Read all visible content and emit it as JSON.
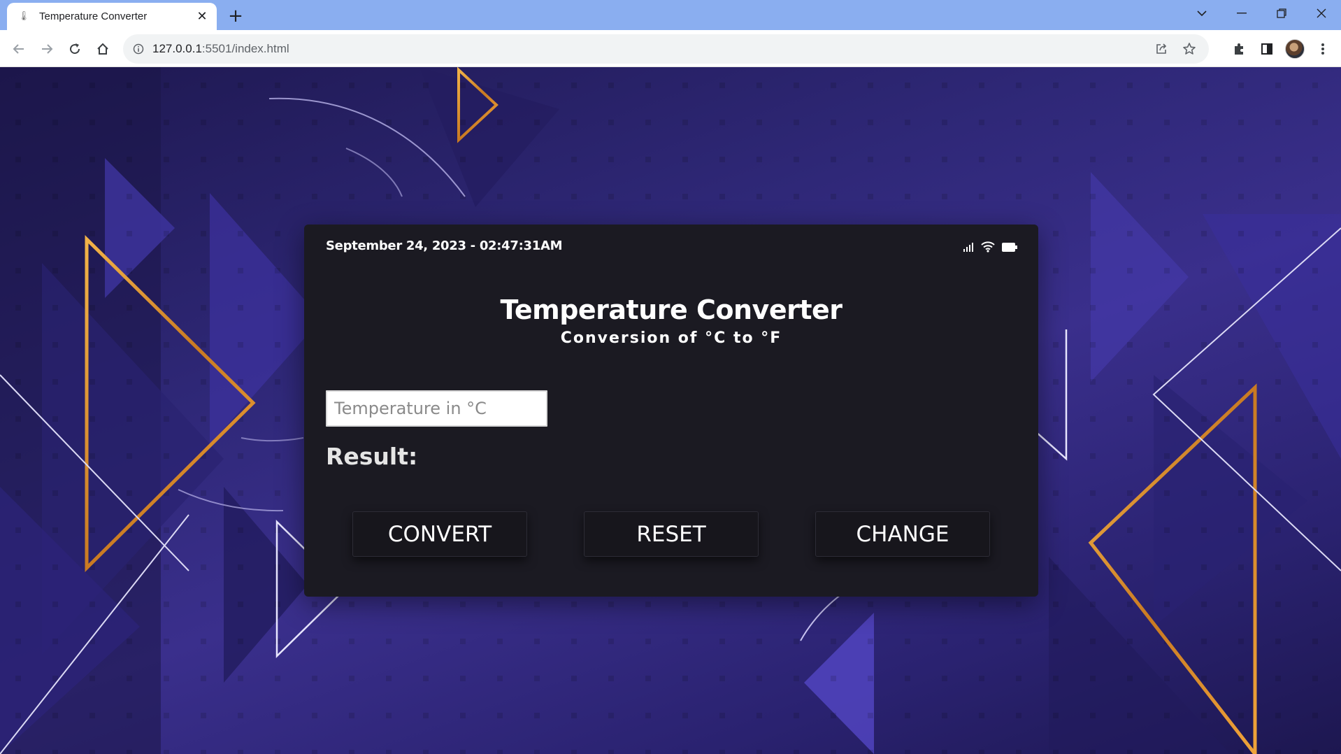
{
  "browser": {
    "tab_title": "Temperature Converter",
    "url_host": "127.0.0.1",
    "url_rest": ":5501/index.html"
  },
  "card": {
    "datetime": "September 24, 2023 - 02:47:31AM",
    "title": "Temperature Converter",
    "subtitle": "Conversion of °C to °F",
    "input_placeholder": "Temperature in °C",
    "input_value": "",
    "result_label": "Result:",
    "buttons": {
      "convert": "CONVERT",
      "reset": "RESET",
      "change": "CHANGE"
    }
  },
  "colors": {
    "tab_strip": "#8aaef0",
    "background_purple": "#2f2878",
    "card": "#1b1a22",
    "gold_accent": "#e59a2e"
  }
}
